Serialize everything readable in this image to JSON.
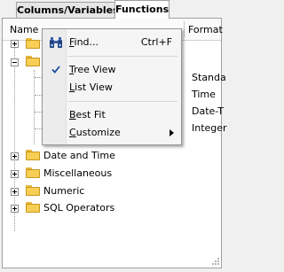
{
  "tabs": {
    "columns_label": "Columns/Variables",
    "functions_label": "Functions"
  },
  "header": {
    "name": "Name",
    "format": "Format"
  },
  "tree": {
    "visible_nodes": [
      "Date and Time",
      "Miscellaneous",
      "Numeric",
      "SQL Operators"
    ],
    "formats": [
      "Standa",
      "Time",
      "Date-T",
      "Integer"
    ]
  },
  "menu": {
    "find": {
      "accel": "F",
      "rest": "ind...",
      "shortcut": "Ctrl+F"
    },
    "tree_view": {
      "accel": "T",
      "rest": "ree View",
      "checked": true
    },
    "list_view": {
      "accel": "L",
      "rest": "ist View"
    },
    "best_fit": {
      "accel": "B",
      "rest": "est Fit"
    },
    "customize": {
      "accel": "C",
      "rest": "ustomize"
    }
  },
  "colors": {
    "folder": "#f6cf54",
    "menu_bg": "#f5f5f5",
    "check": "#1a4aa0"
  }
}
